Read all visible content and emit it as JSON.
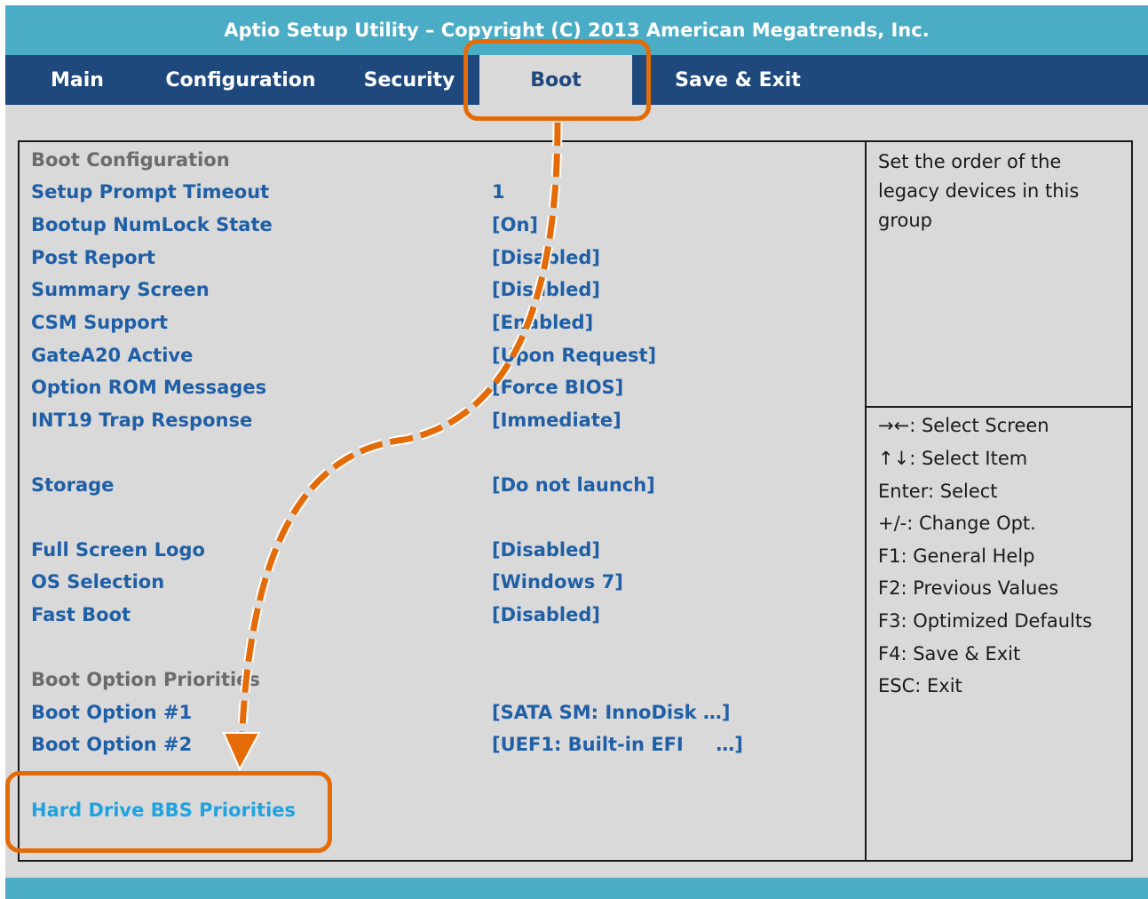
{
  "title": "Aptio Setup Utility – Copyright (C) 2013 American Megatrends, Inc.",
  "tabs": [
    {
      "label": "Main"
    },
    {
      "label": "Configuration"
    },
    {
      "label": "Security"
    },
    {
      "label": "Boot",
      "active": true
    },
    {
      "label": "Save & Exit"
    }
  ],
  "settings": {
    "boot_configuration_header": "Boot Configuration",
    "rows": [
      {
        "label": "Setup Prompt Timeout",
        "value": "1"
      },
      {
        "label": "Bootup NumLock State",
        "value": "[On]"
      },
      {
        "label": "Post Report",
        "value": "[Disabled]"
      },
      {
        "label": "Summary Screen",
        "value": "[Disabled]"
      },
      {
        "label": "CSM Support",
        "value": "[Enabled]"
      },
      {
        "label": "GateA20 Active",
        "value": "[Upon Request]"
      },
      {
        "label": "Option ROM Messages",
        "value": "[Force BIOS]"
      },
      {
        "label": "INT19 Trap Response",
        "value": "[Immediate]"
      },
      {
        "label": "Storage",
        "value": "[Do not launch]"
      },
      {
        "label": "Full Screen Logo",
        "value": "[Disabled]"
      },
      {
        "label": "OS Selection",
        "value": "[Windows 7]"
      },
      {
        "label": "Fast Boot",
        "value": "[Disabled]"
      }
    ],
    "boot_option_priorities_header": "Boot Option Priorities",
    "boot_options": [
      {
        "label": "Boot Option #1",
        "value": "[SATA SM: InnoDisk …]"
      },
      {
        "label": "Boot Option #2",
        "value": "[UEF1: Built-in EFI     …]"
      }
    ],
    "hard_drive_bbs": "Hard Drive BBS Priorities"
  },
  "help": {
    "description": "Set the order of the legacy devices in this group",
    "keys": [
      "→←: Select Screen",
      "↑↓: Select Item",
      "Enter: Select",
      "+/-: Change Opt.",
      "F1: General Help",
      "F2: Previous Values",
      "F3: Optimized Defaults",
      "F4: Save & Exit",
      "ESC: Exit"
    ]
  },
  "colors": {
    "title_bar": "#4bacc6",
    "tab_bar": "#1f497d",
    "item_text": "#1f5fa6",
    "highlight_text": "#1fa3e0",
    "callout": "#e36c09"
  }
}
